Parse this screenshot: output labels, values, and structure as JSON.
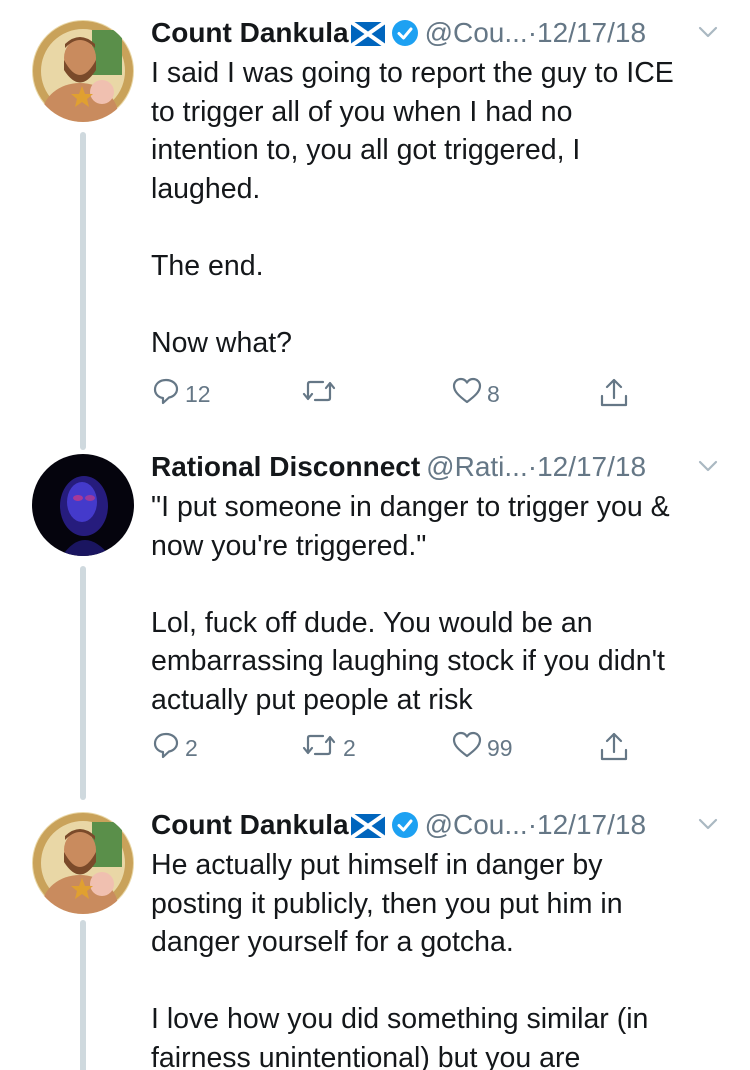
{
  "tweets": [
    {
      "name": "Count Dankula",
      "handle": "@Cou...",
      "separator": "·",
      "date": "12/17/18",
      "avatar_icon": "avatar-illustrated-man-icon",
      "text": "I said I was going to report the guy to ICE\nto trigger all of you when I had no\nintention to, you all got triggered, I\nlaughed.\n\nThe end.\n\nNow what?",
      "reply_count": "12",
      "retweet_count": "",
      "like_count": "8"
    },
    {
      "name": "Rational Disconnect",
      "handle": "@Rati...",
      "separator": "·",
      "date": "12/17/18",
      "avatar_icon": "avatar-dark-blue-portrait-icon",
      "text": "\"I put someone in danger to trigger you &\nnow you're triggered.\"\n\nLol, fuck off dude. You would be an\nembarrassing laughing stock if you didn't\nactually put people at risk",
      "reply_count": "2",
      "retweet_count": "2",
      "like_count": "99"
    },
    {
      "name": "Count Dankula",
      "handle": "@Cou...",
      "separator": "·",
      "date": "12/17/18",
      "avatar_icon": "avatar-illustrated-man-icon",
      "text": "He actually put himself in danger by\nposting it publicly, then you put him in\ndanger yourself for a gotcha.\n\nI love how you did something similar (in\nfairness unintentional) but you are"
    }
  ],
  "colors": {
    "text": "#14171a",
    "muted": "#657786",
    "verified": "#1da1f2",
    "thread_line": "#cfd9de"
  }
}
